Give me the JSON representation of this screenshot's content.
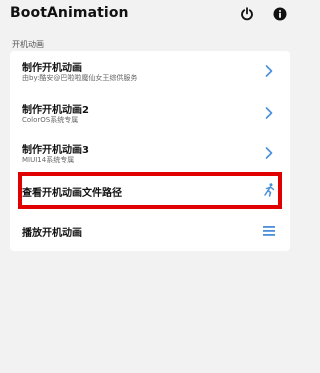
{
  "app": {
    "title": "BootAnimation"
  },
  "toolbar": {
    "power_icon": "power-icon",
    "info_icon": "info-icon"
  },
  "section": {
    "title": "开机动画"
  },
  "items": [
    {
      "title": "制作开机动画",
      "subtitle": "由by:酷安@巴啦啦魔仙女王综供服务",
      "icon": "chevron-right-icon"
    },
    {
      "title": "制作开机动画2",
      "subtitle": "ColorOS系统专属",
      "icon": "chevron-right-icon"
    },
    {
      "title": "制作开机动画3",
      "subtitle": "MIUI14系统专属",
      "icon": "chevron-right-icon"
    },
    {
      "title": "查看开机动画文件路径",
      "icon": "running-person-icon"
    },
    {
      "title": "播放开机动画",
      "icon": "menu-icon"
    }
  ],
  "colors": {
    "accent": "#4a8fd8",
    "highlight": "#e00000",
    "background": "#f2f2f2"
  }
}
